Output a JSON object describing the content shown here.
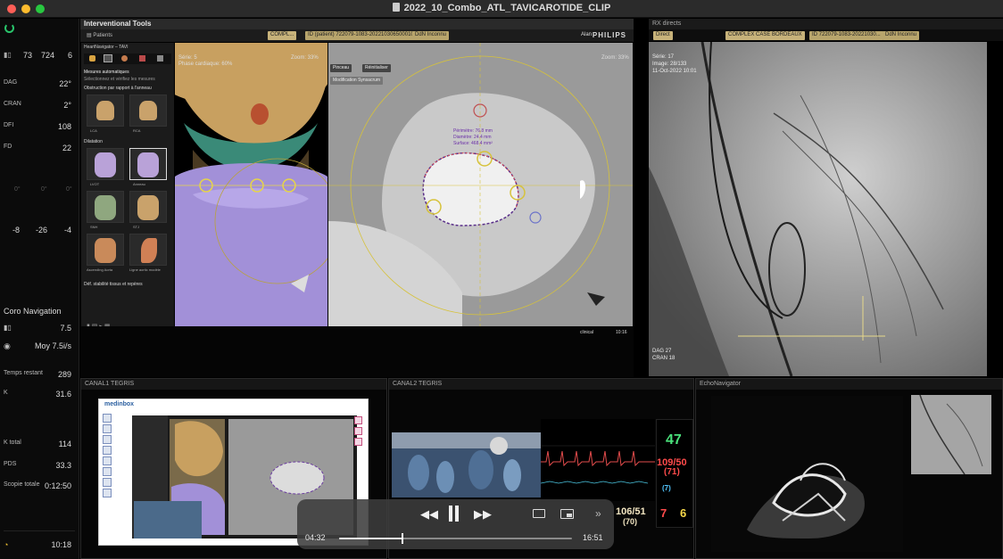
{
  "window": {
    "title": "2022_10_Combo_ATL_TAVICAROTIDE_CLIP"
  },
  "left_panel": {
    "top_row": [
      "73",
      "724",
      "6"
    ],
    "top_row_units": [
      "",
      "",
      "ms"
    ],
    "angles": [
      {
        "label": "DAG",
        "value": "22°"
      },
      {
        "label": "CRAN",
        "value": "2°"
      },
      {
        "label": "DFI",
        "value": "108"
      },
      {
        "label": "FD",
        "value": "22"
      }
    ],
    "zero_row": [
      "0°",
      "0°",
      "0°"
    ],
    "table_row": [
      "-8",
      "-26",
      "-4"
    ],
    "coro_title": "Coro Navigation",
    "coro_rate": "7.5",
    "moy": "Moy 7.5i/s",
    "temps_label": "Temps restant",
    "temps_value": "289",
    "k_label": "K",
    "k_value": "31.6",
    "k_total_label": "K total",
    "k_total_value": "114",
    "pds_label": "PDS",
    "pds_value": "33.3",
    "scopie_label": "Scopie totale",
    "scopie_value": "0:12:50",
    "clock": "10:18"
  },
  "interventional": {
    "title": "Interventional Tools",
    "tab_patients": "Patients",
    "chip_complex": "COMPL...",
    "chip_id": "ID (patient) 722079-1083-2022103065000102",
    "chip_ddn": "DdN Inconnu",
    "alan": "Alan",
    "brand": "PHILIPS",
    "heartnav_title": "HeartNavigator – TAVI",
    "mesures_title": "Mesures automatiques",
    "mesures_sub": "Sélectionnez et vérifiez les mesures",
    "obstruction": "Obstruction par rapport à l'anneau",
    "lca": "LCA",
    "rca": "RCA",
    "dilatation": "Dilatation",
    "thumbs": [
      "LVOT",
      "Anneau",
      "SNH",
      "STJ",
      "Ascending Aorta",
      "Ligne aortic modèle"
    ],
    "footer_btn": "Déf. stabilité tissus et repères",
    "view3d_label": "Série: 5",
    "view3d_sub": "Phase cardiaque: 60%",
    "zoom3d": "Zoom: 33%",
    "ct_btn1": "Pinceau",
    "ct_btn2": "Réinitialiser",
    "ct_btn3": "Modification Synsacrum",
    "ct_zoom": "Zoom: 33%",
    "ct_measure1": "Périmètre: 76.8 mm",
    "ct_measure2": "Diamètre: 24.4 mm",
    "ct_measure3": "Surface: 468.4 mm²",
    "status_clinical": "clinical",
    "status_time": "10:16"
  },
  "xray": {
    "title": "RX directs",
    "chip_direct": "Direct",
    "chip_case": "COMPLEX CASE BORDEAUX",
    "chip_id": "ID 722079-1083-20221030...",
    "chip_ddn": "DdN Inconnu",
    "series": "Série: 17",
    "image": "Image: 28/133",
    "date": "11-Oct-2022 10:01",
    "dag": "DAG 27",
    "cran": "CRAN 18"
  },
  "bottom": {
    "canal1": "CANAL1 TEGRIS",
    "canal2": "CANAL2 TEGRIS",
    "echo": "EchoNavigator",
    "medinbox": "medinbox",
    "hr": "47",
    "bp": "109/50",
    "bp_mean": "(71)",
    "nibp": "106/51",
    "nibp_mean": "(70)",
    "v7": "7",
    "v6": "6",
    "small_mean": "(7)"
  },
  "player": {
    "current": "04:32",
    "total": "16:51",
    "progress": 0.2735
  }
}
